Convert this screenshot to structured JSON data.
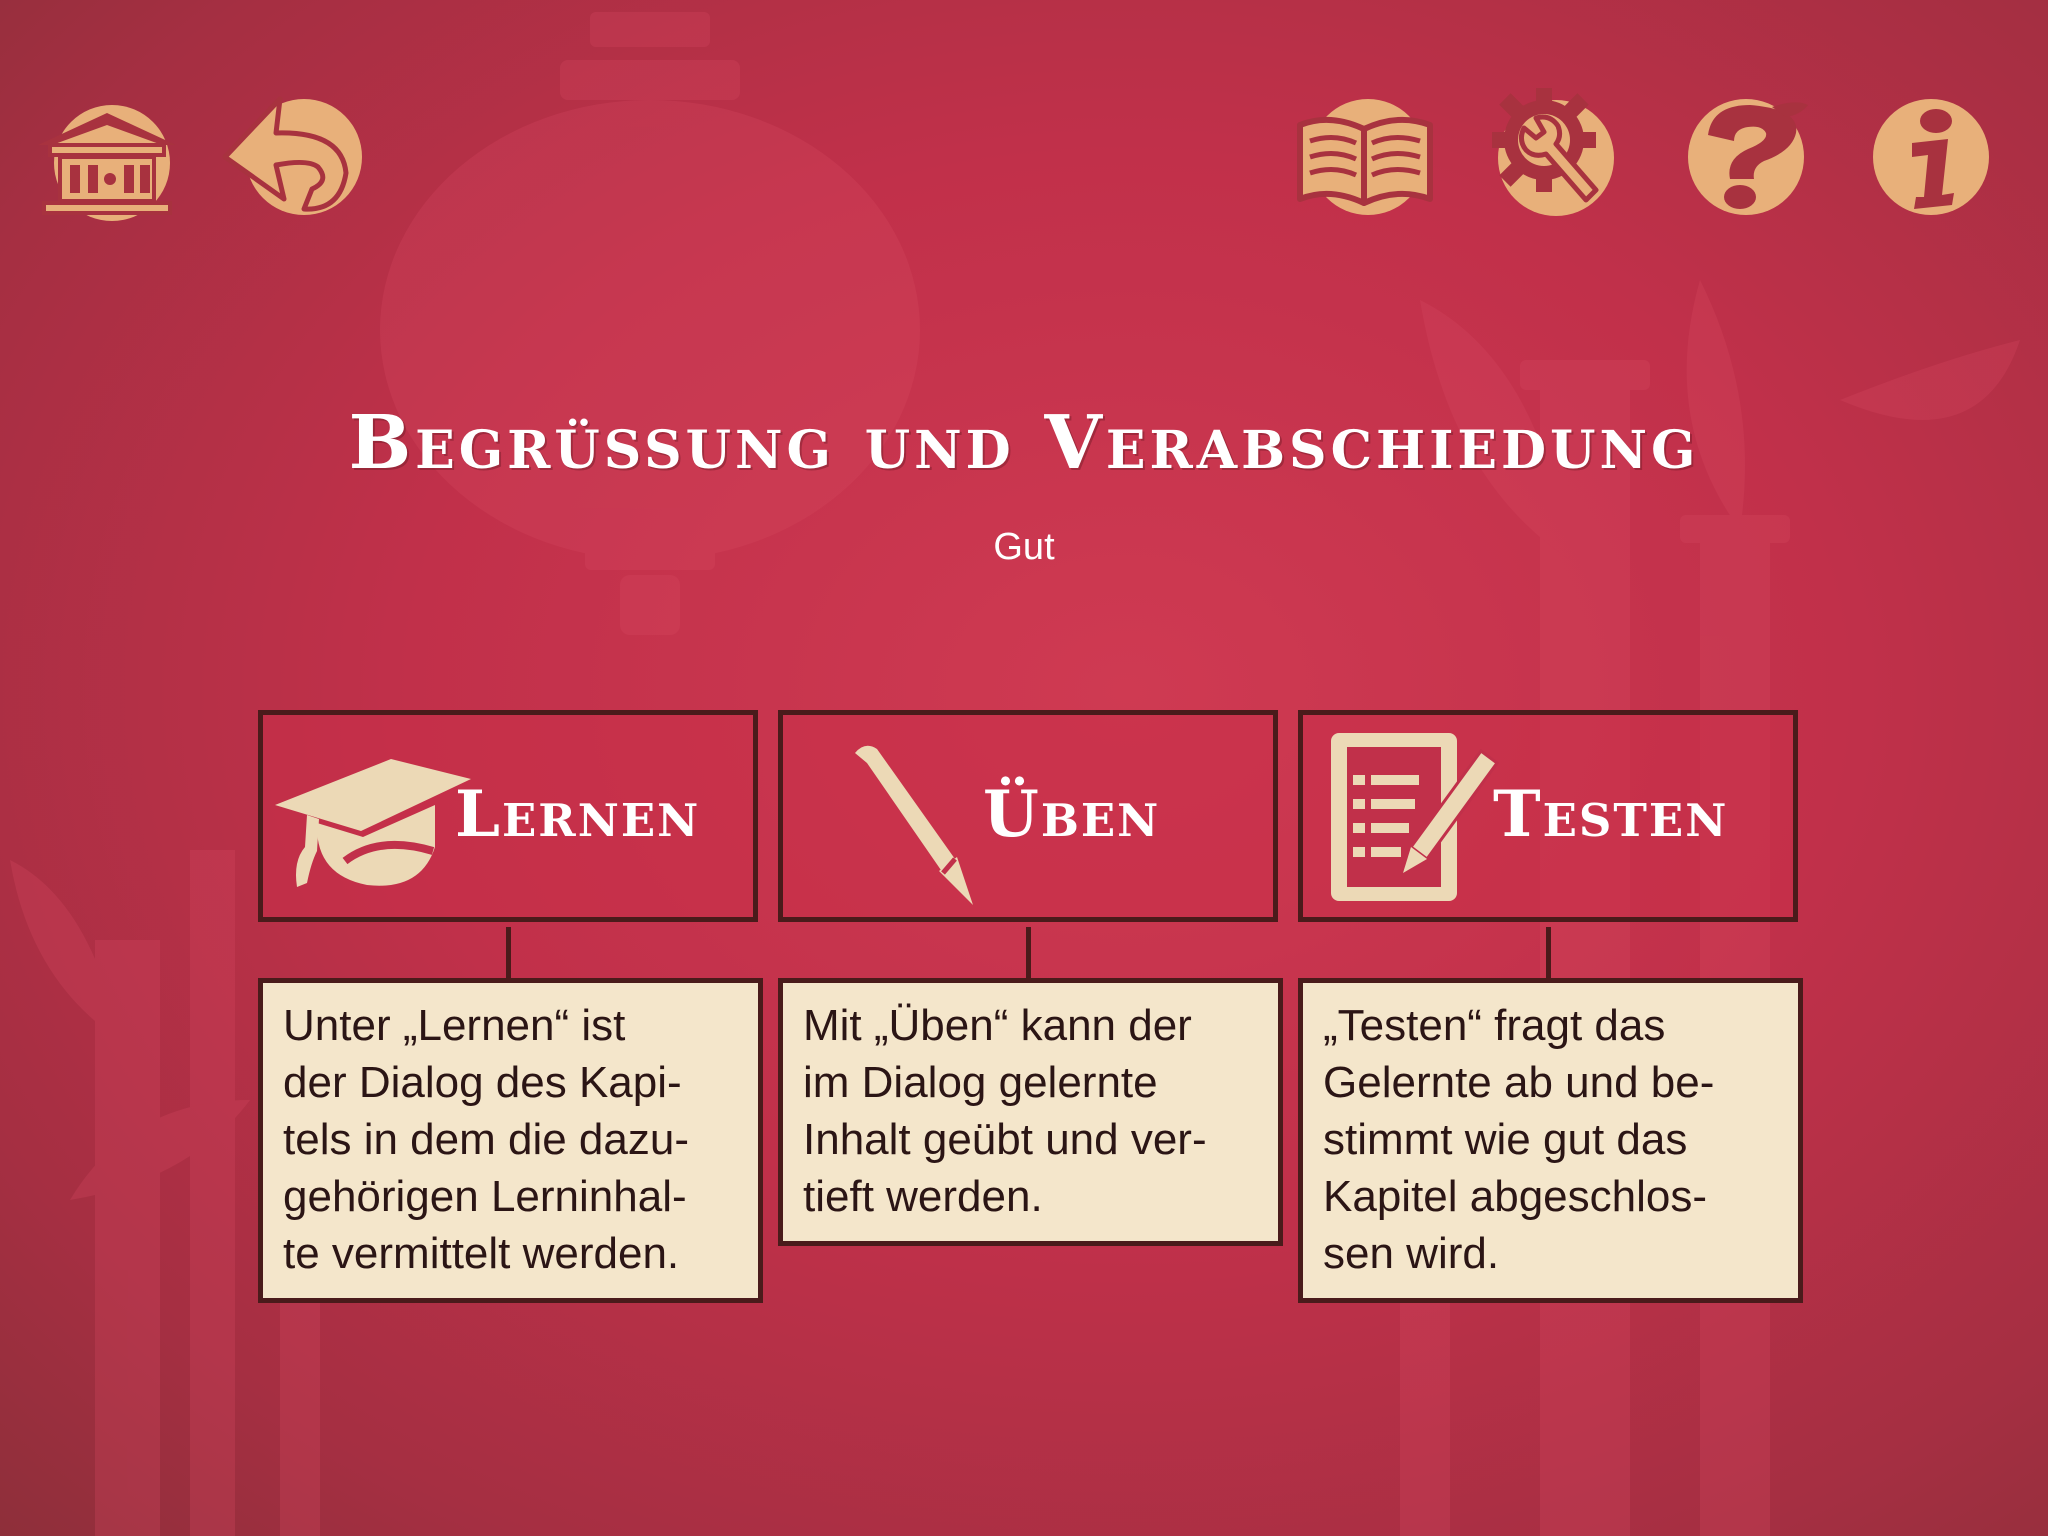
{
  "header": {
    "title": "Begrüssung und Verabschiedung",
    "subtitle": "Gut"
  },
  "toolbar": {
    "left": [
      "home-temple-icon",
      "back-arrow-icon"
    ],
    "right": [
      "book-icon",
      "settings-wrench-gear-icon",
      "help-question-icon",
      "info-icon"
    ]
  },
  "modes": [
    {
      "label": "Lernen",
      "icon": "graduation-cap-icon",
      "description": "Unter „Lernen“ ist\nder Dialog des Kapi-\ntels in dem die dazu-\ngehörigen Lerninhal-\nte vermittelt werden."
    },
    {
      "label": "Üben",
      "icon": "pencil-icon",
      "description": "Mit „Üben“ kann der\nim Dialog gelernte\nInhalt geübt und ver-\ntieft werden."
    },
    {
      "label": "Testen",
      "icon": "checklist-pencil-icon",
      "description": "„Testen“ fragt das\nGelernte ab und be-\nstimmt wie gut das\nKapitel abgeschlos-\nsen wird."
    }
  ],
  "colors": {
    "background": "#c1304a",
    "icon_fill": "#e8b07a",
    "icon_dark": "#a8323f",
    "border": "#4a1b1b",
    "box_fill": "#f4e6cb"
  }
}
